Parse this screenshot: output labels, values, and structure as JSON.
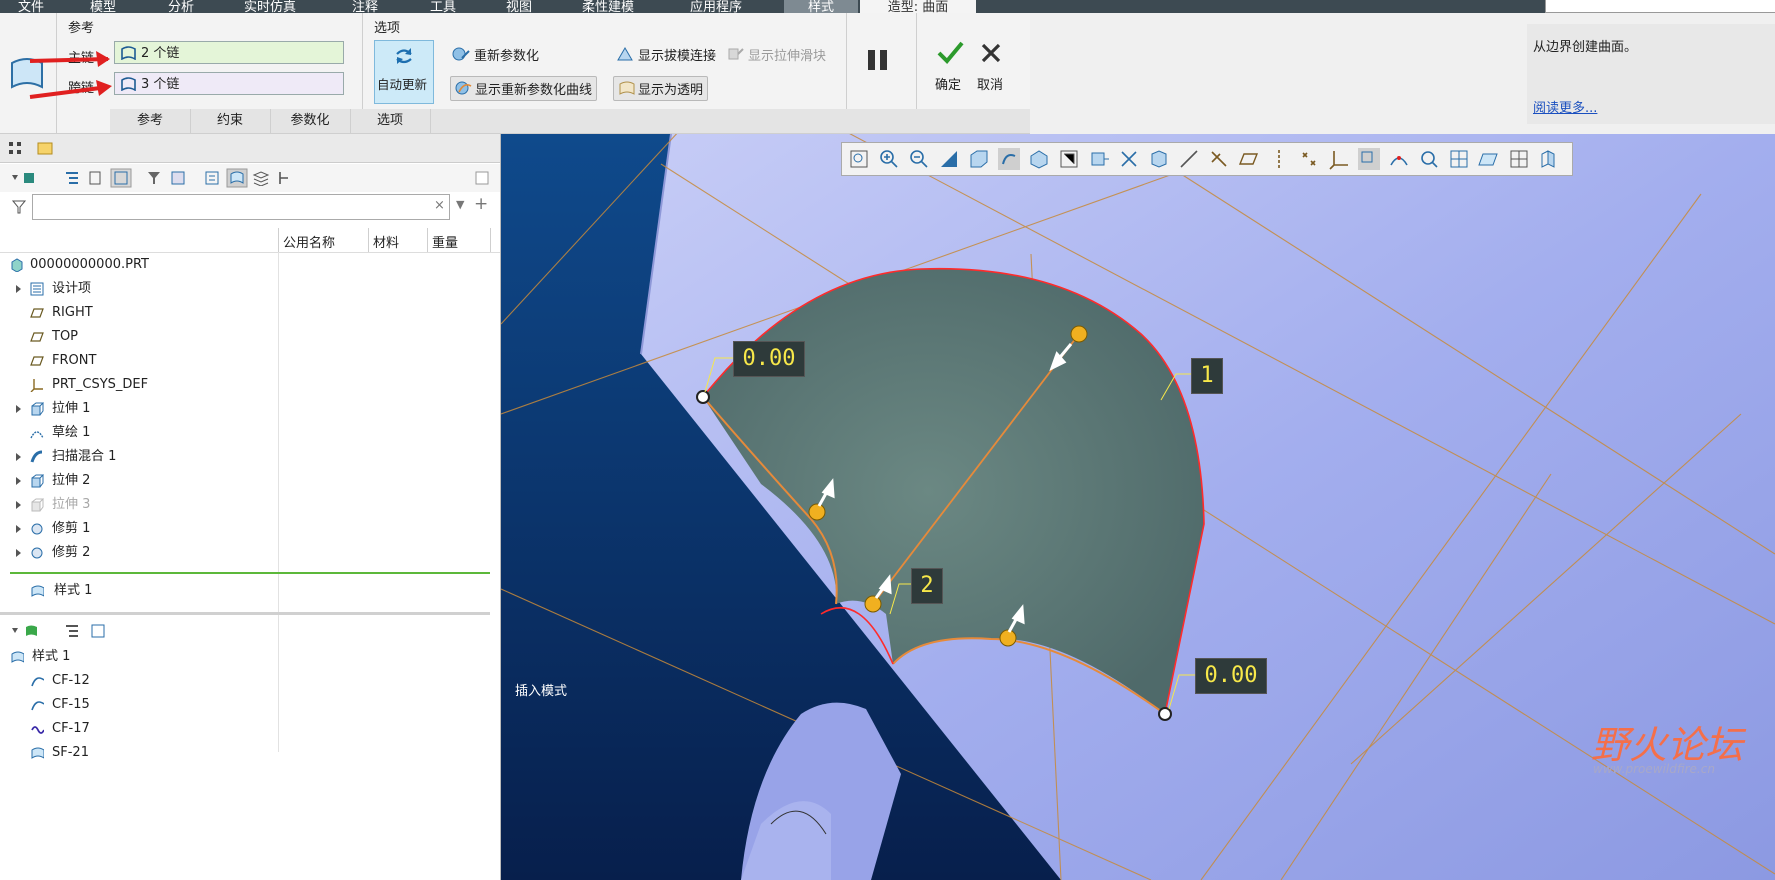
{
  "menubar": {
    "items": [
      "文件",
      "模型",
      "分析",
      "实时仿真",
      "注释",
      "工具",
      "视图",
      "柔性建模",
      "应用程序",
      "样式"
    ],
    "context_tab": "造型: 曲面",
    "colors": {
      "bar": "#3d4a52",
      "active": "#7e8a92"
    }
  },
  "ribbon": {
    "ref_group_title": "参考",
    "primary_label": "主链",
    "cross_label": "跨链",
    "primary_value": "2 个链",
    "cross_value": "3 个链",
    "options_group_title": "选项",
    "auto_update": "自动更新",
    "reparam": "重新参数化",
    "show_draft": "显示拔模连接",
    "show_slider": "显示拉伸滑块",
    "show_reparam_curves": "显示重新参数化曲线",
    "show_transparent": "显示为透明",
    "ok": "确定",
    "cancel": "取消",
    "tabs": [
      "参考",
      "约束",
      "参数化",
      "选项"
    ]
  },
  "help": {
    "text": "从边界创建曲面。",
    "link": "阅读更多..."
  },
  "left_panel": {
    "filter_placeholder": "",
    "columns": [
      "公用名称",
      "材料",
      "重量"
    ],
    "model_tree": [
      {
        "label": "00000000000.PRT",
        "icon": "part-icon",
        "expandable": false,
        "dim": false
      },
      {
        "label": "设计项",
        "icon": "design-items-icon",
        "expandable": true,
        "dim": false
      },
      {
        "label": "RIGHT",
        "icon": "datum-plane-icon",
        "expandable": false,
        "dim": false
      },
      {
        "label": "TOP",
        "icon": "datum-plane-icon",
        "expandable": false,
        "dim": false
      },
      {
        "label": "FRONT",
        "icon": "datum-plane-icon",
        "expandable": false,
        "dim": false
      },
      {
        "label": "PRT_CSYS_DEF",
        "icon": "csys-icon",
        "expandable": false,
        "dim": false
      },
      {
        "label": "拉伸 1",
        "icon": "extrude-icon",
        "expandable": true,
        "dim": false
      },
      {
        "label": "草绘 1",
        "icon": "sketch-icon",
        "expandable": false,
        "dim": false
      },
      {
        "label": "扫描混合 1",
        "icon": "swept-blend-icon",
        "expandable": true,
        "dim": false
      },
      {
        "label": "拉伸 2",
        "icon": "extrude-icon",
        "expandable": true,
        "dim": false
      },
      {
        "label": "拉伸 3",
        "icon": "extrude-icon",
        "expandable": true,
        "dim": true
      },
      {
        "label": "修剪 1",
        "icon": "trim-icon",
        "expandable": true,
        "dim": false
      },
      {
        "label": "修剪 2",
        "icon": "trim-icon",
        "expandable": true,
        "dim": false
      }
    ],
    "insert_item": "样式 1",
    "style_tree_root": "样式 1",
    "style_tree": [
      {
        "label": "CF-12",
        "icon": "curve-free-icon"
      },
      {
        "label": "CF-15",
        "icon": "curve-free-icon"
      },
      {
        "label": "CF-17",
        "icon": "curve-free-wave-icon"
      },
      {
        "label": "SF-21",
        "icon": "surface-icon"
      }
    ]
  },
  "viewport": {
    "dims": {
      "d1": "0.00",
      "d2": "0.00"
    },
    "labels": {
      "one": "1",
      "two": "2"
    },
    "mode_text": "插入模式",
    "watermark_main": "野火论坛",
    "watermark_url": "www.proewildfire.cn",
    "colors": {
      "bg": "#0a2f6a",
      "surface": "#5f7b76",
      "cylinder": "#a6b0ef",
      "orange": "#e08a3a",
      "red": "#ff2020"
    }
  }
}
